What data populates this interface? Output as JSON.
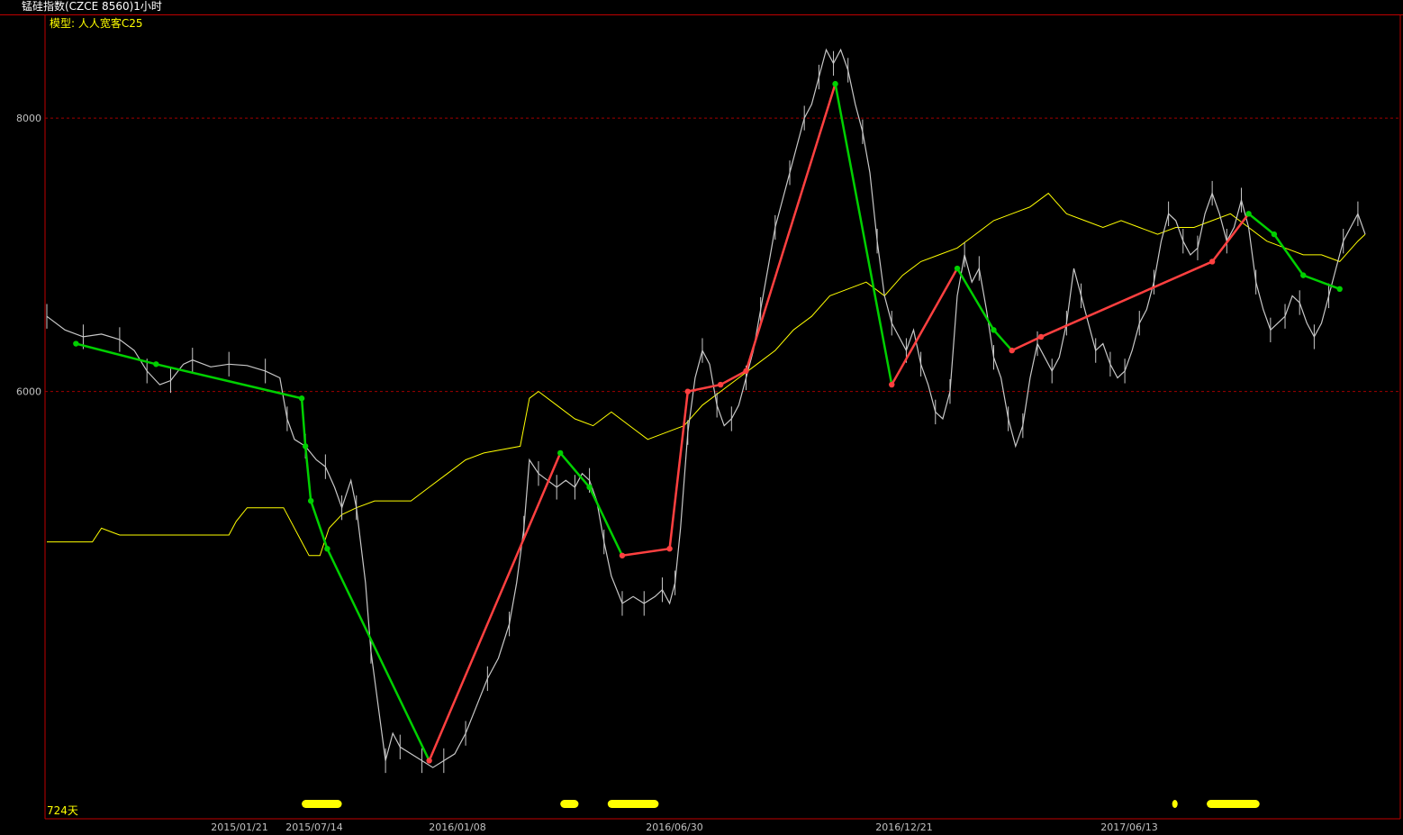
{
  "window": {
    "title": "锰硅指数(CZCE 8560)1小时"
  },
  "chart_data": {
    "type": "line",
    "model_label": "模型: 人人宽客C25",
    "days_label": "724天",
    "ylim": [
      3000,
      8600
    ],
    "y_ticks": [
      6000,
      8000
    ],
    "x_ticks": [
      "2015/01/21",
      "2015/07/14",
      "2016/01/08",
      "2016/06/30",
      "2016/12/21",
      "2017/06/13"
    ],
    "grid": "horizontal dashed at y ticks",
    "colors": {
      "price": "#c8c8c8",
      "average": "#ffff00",
      "up_swing": "#ff4040",
      "down_swing": "#00d000",
      "frame": "#c00000",
      "grid": "#a00000",
      "markers": "#ffff00"
    },
    "series": [
      {
        "name": "",
        "role": "price",
        "values": [
          [
            0,
            6550
          ],
          [
            10,
            6450
          ],
          [
            20,
            6400
          ],
          [
            30,
            6420
          ],
          [
            40,
            6380
          ],
          [
            48,
            6300
          ],
          [
            55,
            6150
          ],
          [
            62,
            6050
          ],
          [
            68,
            6080
          ],
          [
            75,
            6200
          ],
          [
            80,
            6230
          ],
          [
            90,
            6180
          ],
          [
            100,
            6200
          ],
          [
            110,
            6190
          ],
          [
            120,
            6150
          ],
          [
            128,
            6100
          ],
          [
            132,
            5800
          ],
          [
            136,
            5650
          ],
          [
            142,
            5600
          ],
          [
            148,
            5500
          ],
          [
            153,
            5450
          ],
          [
            158,
            5300
          ],
          [
            162,
            5150
          ],
          [
            167,
            5350
          ],
          [
            170,
            5150
          ],
          [
            175,
            4600
          ],
          [
            178,
            4100
          ],
          [
            182,
            3700
          ],
          [
            186,
            3300
          ],
          [
            190,
            3500
          ],
          [
            194,
            3400
          ],
          [
            200,
            3350
          ],
          [
            206,
            3300
          ],
          [
            212,
            3250
          ],
          [
            218,
            3300
          ],
          [
            224,
            3350
          ],
          [
            230,
            3500
          ],
          [
            236,
            3700
          ],
          [
            242,
            3900
          ],
          [
            248,
            4050
          ],
          [
            254,
            4300
          ],
          [
            258,
            4600
          ],
          [
            262,
            5000
          ],
          [
            265,
            5500
          ],
          [
            270,
            5400
          ],
          [
            275,
            5350
          ],
          [
            280,
            5300
          ],
          [
            285,
            5350
          ],
          [
            290,
            5300
          ],
          [
            294,
            5400
          ],
          [
            298,
            5350
          ],
          [
            302,
            5200
          ],
          [
            306,
            4900
          ],
          [
            310,
            4650
          ],
          [
            316,
            4450
          ],
          [
            322,
            4500
          ],
          [
            328,
            4450
          ],
          [
            334,
            4500
          ],
          [
            338,
            4550
          ],
          [
            342,
            4450
          ],
          [
            345,
            4600
          ],
          [
            348,
            5000
          ],
          [
            352,
            5700
          ],
          [
            356,
            6100
          ],
          [
            360,
            6300
          ],
          [
            364,
            6200
          ],
          [
            368,
            5900
          ],
          [
            372,
            5750
          ],
          [
            376,
            5800
          ],
          [
            380,
            5900
          ],
          [
            384,
            6100
          ],
          [
            388,
            6300
          ],
          [
            392,
            6600
          ],
          [
            396,
            6900
          ],
          [
            400,
            7200
          ],
          [
            404,
            7400
          ],
          [
            408,
            7600
          ],
          [
            412,
            7800
          ],
          [
            416,
            8000
          ],
          [
            420,
            8100
          ],
          [
            424,
            8300
          ],
          [
            428,
            8500
          ],
          [
            432,
            8400
          ],
          [
            436,
            8500
          ],
          [
            440,
            8350
          ],
          [
            444,
            8100
          ],
          [
            448,
            7900
          ],
          [
            452,
            7600
          ],
          [
            456,
            7100
          ],
          [
            460,
            6700
          ],
          [
            464,
            6500
          ],
          [
            468,
            6400
          ],
          [
            472,
            6300
          ],
          [
            476,
            6450
          ],
          [
            480,
            6200
          ],
          [
            484,
            6050
          ],
          [
            488,
            5850
          ],
          [
            492,
            5800
          ],
          [
            496,
            6000
          ],
          [
            500,
            6700
          ],
          [
            504,
            7000
          ],
          [
            508,
            6800
          ],
          [
            512,
            6900
          ],
          [
            516,
            6600
          ],
          [
            520,
            6250
          ],
          [
            524,
            6100
          ],
          [
            528,
            5800
          ],
          [
            532,
            5600
          ],
          [
            536,
            5750
          ],
          [
            540,
            6100
          ],
          [
            544,
            6350
          ],
          [
            548,
            6250
          ],
          [
            552,
            6150
          ],
          [
            556,
            6250
          ],
          [
            560,
            6500
          ],
          [
            564,
            6900
          ],
          [
            568,
            6700
          ],
          [
            572,
            6500
          ],
          [
            576,
            6300
          ],
          [
            580,
            6350
          ],
          [
            584,
            6200
          ],
          [
            588,
            6100
          ],
          [
            592,
            6150
          ],
          [
            596,
            6300
          ],
          [
            600,
            6500
          ],
          [
            604,
            6600
          ],
          [
            608,
            6800
          ],
          [
            612,
            7100
          ],
          [
            616,
            7300
          ],
          [
            620,
            7250
          ],
          [
            624,
            7100
          ],
          [
            628,
            7000
          ],
          [
            632,
            7050
          ],
          [
            636,
            7300
          ],
          [
            640,
            7450
          ],
          [
            644,
            7300
          ],
          [
            648,
            7100
          ],
          [
            652,
            7200
          ],
          [
            656,
            7400
          ],
          [
            660,
            7200
          ],
          [
            664,
            6800
          ],
          [
            668,
            6600
          ],
          [
            672,
            6450
          ],
          [
            676,
            6500
          ],
          [
            680,
            6550
          ],
          [
            684,
            6700
          ],
          [
            688,
            6650
          ],
          [
            692,
            6500
          ],
          [
            696,
            6400
          ],
          [
            700,
            6500
          ],
          [
            704,
            6700
          ],
          [
            708,
            6900
          ],
          [
            712,
            7100
          ],
          [
            716,
            7200
          ],
          [
            720,
            7300
          ],
          [
            724,
            7150
          ]
        ]
      },
      {
        "name": "",
        "role": "average",
        "values": [
          [
            0,
            4900
          ],
          [
            25,
            4900
          ],
          [
            30,
            5000
          ],
          [
            40,
            4950
          ],
          [
            60,
            4950
          ],
          [
            100,
            4950
          ],
          [
            104,
            5050
          ],
          [
            110,
            5150
          ],
          [
            130,
            5150
          ],
          [
            140,
            4900
          ],
          [
            144,
            4800
          ],
          [
            150,
            4800
          ],
          [
            155,
            5000
          ],
          [
            162,
            5100
          ],
          [
            170,
            5150
          ],
          [
            180,
            5200
          ],
          [
            190,
            5200
          ],
          [
            200,
            5200
          ],
          [
            210,
            5300
          ],
          [
            220,
            5400
          ],
          [
            230,
            5500
          ],
          [
            240,
            5550
          ],
          [
            260,
            5600
          ],
          [
            265,
            5950
          ],
          [
            270,
            6000
          ],
          [
            280,
            5900
          ],
          [
            290,
            5800
          ],
          [
            300,
            5750
          ],
          [
            305,
            5800
          ],
          [
            310,
            5850
          ],
          [
            320,
            5750
          ],
          [
            330,
            5650
          ],
          [
            340,
            5700
          ],
          [
            350,
            5750
          ],
          [
            360,
            5900
          ],
          [
            370,
            6000
          ],
          [
            380,
            6100
          ],
          [
            390,
            6200
          ],
          [
            400,
            6300
          ],
          [
            410,
            6450
          ],
          [
            420,
            6550
          ],
          [
            430,
            6700
          ],
          [
            440,
            6750
          ],
          [
            450,
            6800
          ],
          [
            460,
            6700
          ],
          [
            470,
            6850
          ],
          [
            480,
            6950
          ],
          [
            490,
            7000
          ],
          [
            500,
            7050
          ],
          [
            510,
            7150
          ],
          [
            520,
            7250
          ],
          [
            530,
            7300
          ],
          [
            540,
            7350
          ],
          [
            550,
            7450
          ],
          [
            560,
            7300
          ],
          [
            570,
            7250
          ],
          [
            580,
            7200
          ],
          [
            590,
            7250
          ],
          [
            600,
            7200
          ],
          [
            610,
            7150
          ],
          [
            620,
            7200
          ],
          [
            630,
            7200
          ],
          [
            640,
            7250
          ],
          [
            650,
            7300
          ],
          [
            660,
            7200
          ],
          [
            670,
            7100
          ],
          [
            680,
            7050
          ],
          [
            690,
            7000
          ],
          [
            700,
            7000
          ],
          [
            710,
            6950
          ],
          [
            720,
            7100
          ],
          [
            724,
            7150
          ]
        ]
      }
    ],
    "swings": [
      [
        [
          16,
          6350
        ],
        [
          60,
          6200
        ],
        [
          140,
          5950
        ],
        [
          142,
          5600
        ],
        [
          145,
          5200
        ],
        [
          154,
          4850
        ],
        [
          210,
          3300
        ],
        [
          282,
          5550
        ],
        [
          298,
          5300
        ],
        [
          316,
          4800
        ],
        [
          342,
          4850
        ],
        [
          352,
          6000
        ],
        [
          370,
          6050
        ],
        [
          384,
          6150
        ],
        [
          433,
          8250
        ],
        [
          464,
          6050
        ],
        [
          500,
          6900
        ],
        [
          520,
          6450
        ],
        [
          530,
          6300
        ],
        [
          546,
          6400
        ],
        [
          640,
          6950
        ],
        [
          660,
          7300
        ],
        [
          674,
          7150
        ],
        [
          690,
          6850
        ],
        [
          710,
          6750
        ]
      ],
      [
        [
          16,
          6350
        ],
        [
          60,
          6200
        ],
        [
          140,
          5950
        ],
        [
          145,
          5200
        ],
        [
          154,
          4850
        ],
        [
          210,
          3300
        ],
        [
          282,
          5550
        ],
        [
          298,
          5300
        ],
        [
          316,
          4800
        ],
        [
          342,
          4850
        ],
        [
          352,
          6000
        ],
        [
          370,
          6050
        ],
        [
          384,
          6150
        ],
        [
          433,
          8250
        ],
        [
          464,
          6050
        ],
        [
          500,
          6900
        ],
        [
          520,
          6450
        ],
        [
          530,
          6300
        ],
        [
          546,
          6400
        ],
        [
          640,
          6950
        ],
        [
          660,
          7300
        ],
        [
          674,
          7150
        ],
        [
          690,
          6850
        ],
        [
          710,
          6750
        ]
      ]
    ],
    "bottom_markers": [
      [
        140,
        162
      ],
      [
        282,
        292
      ],
      [
        308,
        336
      ],
      [
        618,
        621
      ],
      [
        637,
        666
      ]
    ]
  }
}
